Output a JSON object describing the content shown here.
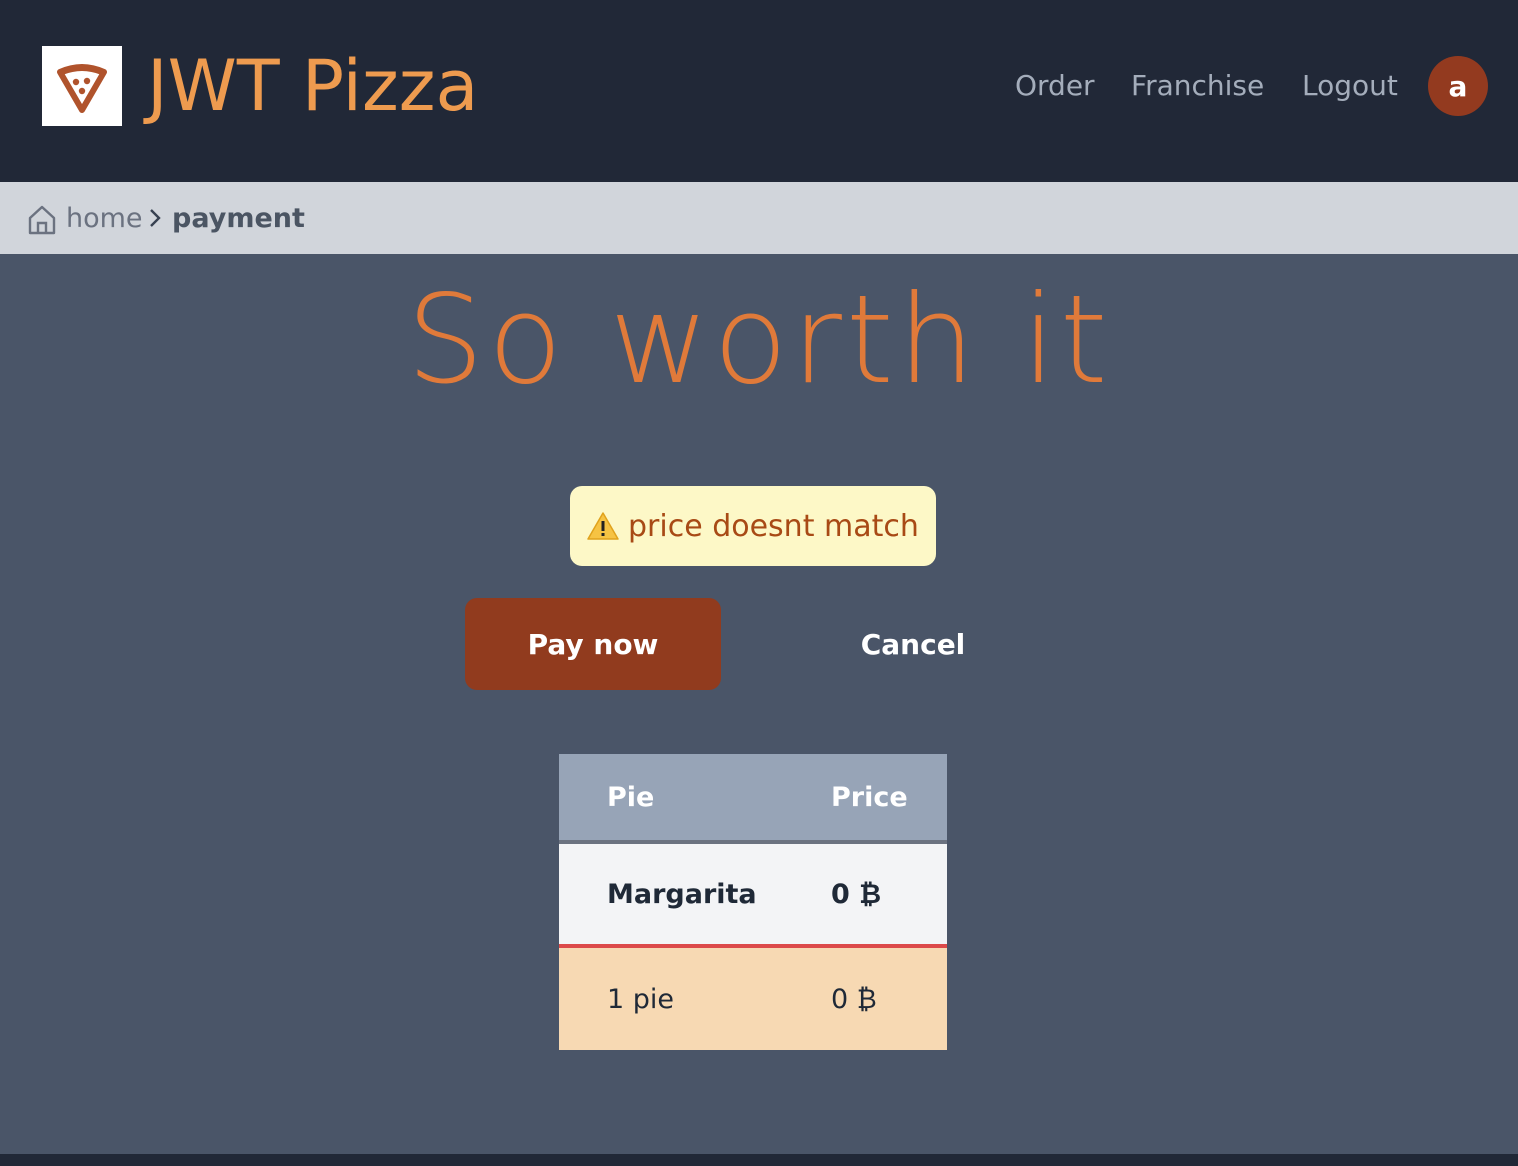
{
  "header": {
    "app_title": "JWT Pizza",
    "nav": [
      {
        "label": "Order"
      },
      {
        "label": "Franchise"
      },
      {
        "label": "Logout"
      }
    ],
    "avatar_initial": "a",
    "brand_color": "#ee9b4f"
  },
  "breadcrumb": {
    "home": "home",
    "current": "payment"
  },
  "main": {
    "title": "So worth it",
    "alert": {
      "icon": "warning-icon",
      "message": "price doesnt match"
    },
    "pay_button": "Pay now",
    "cancel_button": "Cancel"
  },
  "order_table": {
    "headers": [
      "Pie",
      "Price"
    ],
    "rows": [
      {
        "pie": "Margarita",
        "price": "0 ₿"
      }
    ],
    "total": {
      "label": "1 pie",
      "price": "0 ₿"
    }
  }
}
